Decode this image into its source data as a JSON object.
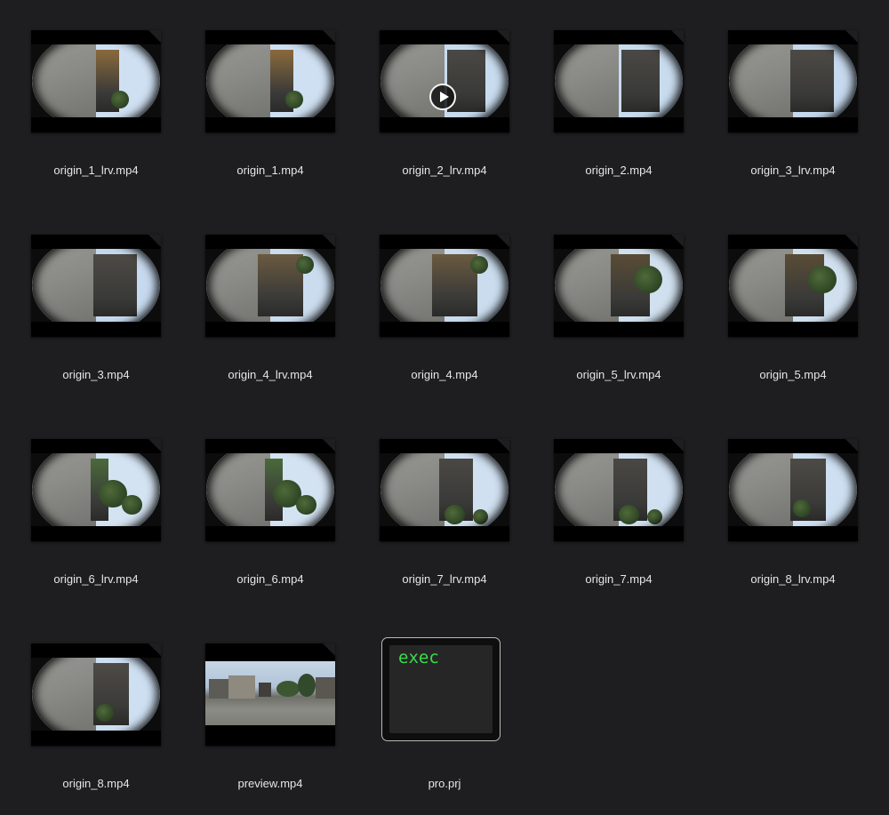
{
  "window": {
    "background": "#1e1e20"
  },
  "files": [
    {
      "name": "origin_1_lrv.mp4",
      "kind": "fisheye-video",
      "scene": "a"
    },
    {
      "name": "origin_1.mp4",
      "kind": "fisheye-video",
      "scene": "a"
    },
    {
      "name": "origin_2_lrv.mp4",
      "kind": "fisheye-video",
      "scene": "b",
      "selected": true,
      "overlay_icon": "play-icon"
    },
    {
      "name": "origin_2.mp4",
      "kind": "fisheye-video",
      "scene": "b"
    },
    {
      "name": "origin_3_lrv.mp4",
      "kind": "fisheye-video",
      "scene": "c"
    },
    {
      "name": "origin_3.mp4",
      "kind": "fisheye-video",
      "scene": "c"
    },
    {
      "name": "origin_4_lrv.mp4",
      "kind": "fisheye-video",
      "scene": "d"
    },
    {
      "name": "origin_4.mp4",
      "kind": "fisheye-video",
      "scene": "d"
    },
    {
      "name": "origin_5_lrv.mp4",
      "kind": "fisheye-video",
      "scene": "e"
    },
    {
      "name": "origin_5.mp4",
      "kind": "fisheye-video",
      "scene": "e"
    },
    {
      "name": "origin_6_lrv.mp4",
      "kind": "fisheye-video",
      "scene": "f"
    },
    {
      "name": "origin_6.mp4",
      "kind": "fisheye-video",
      "scene": "f"
    },
    {
      "name": "origin_7_lrv.mp4",
      "kind": "fisheye-video",
      "scene": "g"
    },
    {
      "name": "origin_7.mp4",
      "kind": "fisheye-video",
      "scene": "g"
    },
    {
      "name": "origin_8_lrv.mp4",
      "kind": "fisheye-video",
      "scene": "h"
    },
    {
      "name": "origin_8.mp4",
      "kind": "fisheye-video",
      "scene": "h"
    },
    {
      "name": "preview.mp4",
      "kind": "panorama-video",
      "scene": "pano"
    },
    {
      "name": "pro.prj",
      "kind": "exec-document",
      "icon_text": "exec",
      "icon_text_color": "#3bdc4c"
    }
  ]
}
